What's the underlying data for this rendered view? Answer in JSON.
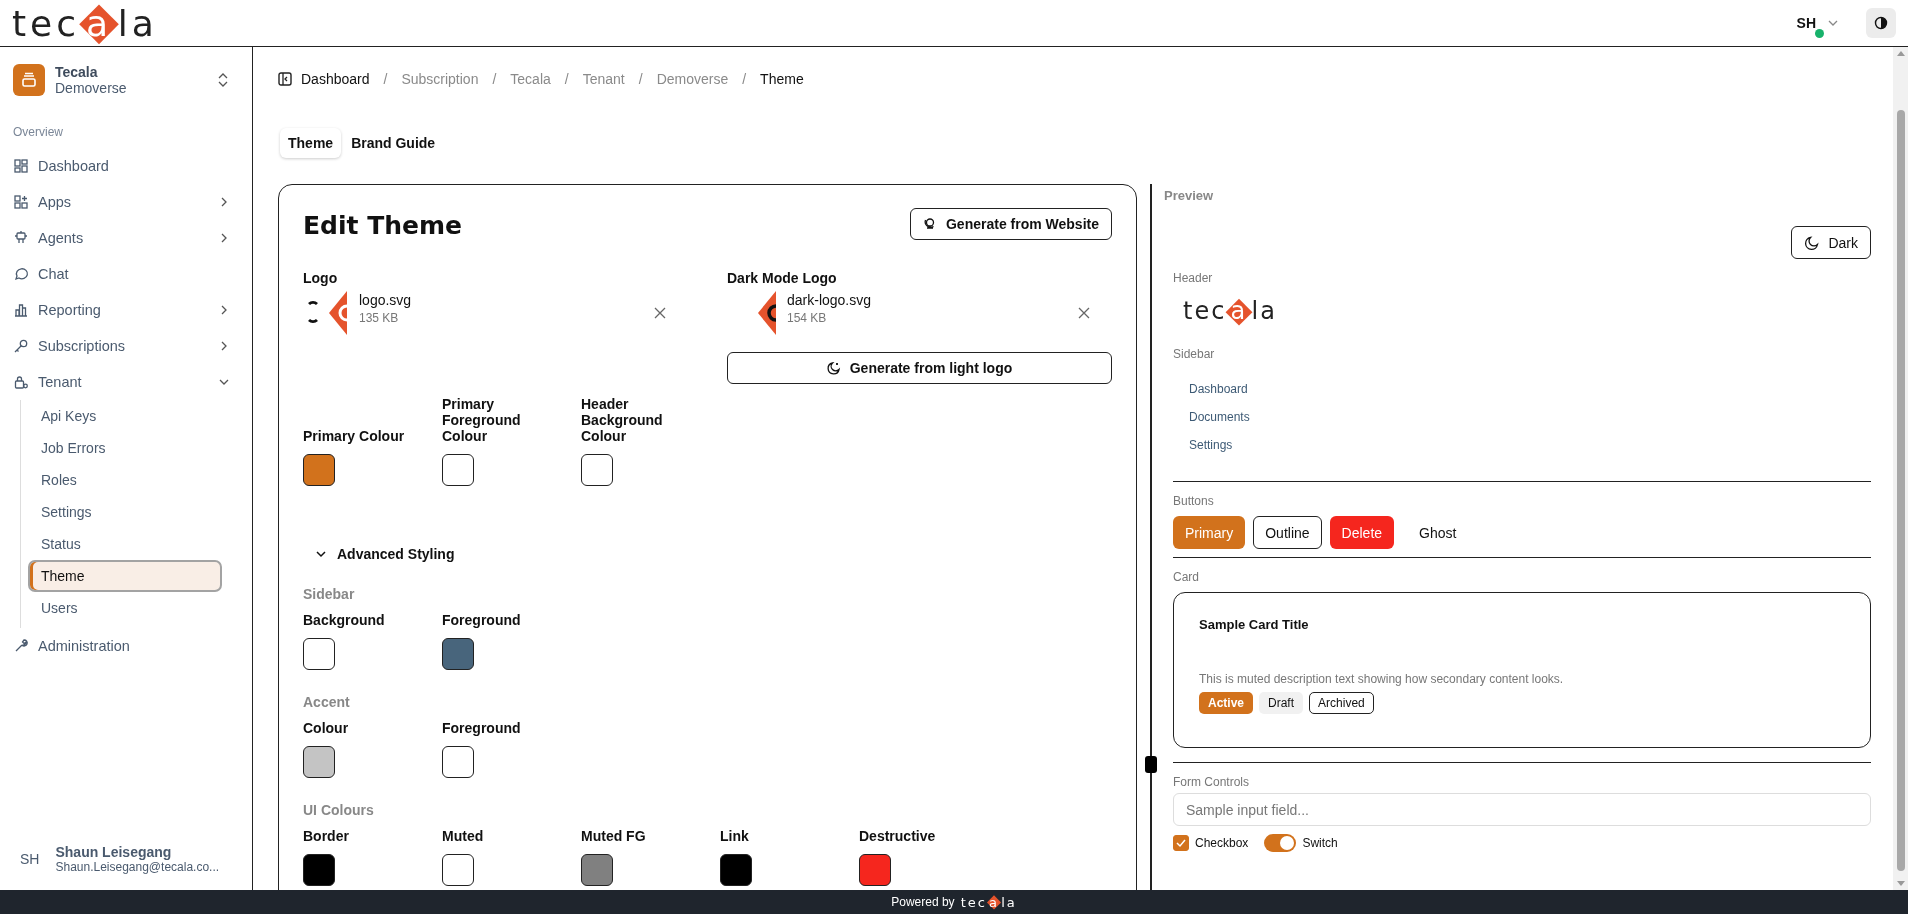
{
  "header": {
    "logo": {
      "lead": "tec",
      "mark": "a",
      "tail": "la"
    },
    "user": {
      "initials": "SH",
      "online": true
    }
  },
  "sidebar": {
    "org": {
      "name": "Tecala",
      "subtitle": "Demoverse"
    },
    "section": "Overview",
    "items": [
      {
        "label": "Dashboard"
      },
      {
        "label": "Apps",
        "expanded": false
      },
      {
        "label": "Agents",
        "expanded": false
      },
      {
        "label": "Chat"
      },
      {
        "label": "Reporting",
        "expanded": false
      },
      {
        "label": "Subscriptions",
        "expanded": false
      },
      {
        "label": "Tenant",
        "expanded": true,
        "children": [
          {
            "label": "Api Keys",
            "selected": false
          },
          {
            "label": "Job Errors",
            "selected": false
          },
          {
            "label": "Roles",
            "selected": false
          },
          {
            "label": "Settings",
            "selected": false
          },
          {
            "label": "Status",
            "selected": false
          },
          {
            "label": "Theme",
            "selected": true
          },
          {
            "label": "Users",
            "selected": false
          }
        ]
      },
      {
        "label": "Administration"
      }
    ],
    "user": {
      "initials": "SH",
      "name": "Shaun Leisegang",
      "email": "Shaun.Leisegang@tecala.co..."
    }
  },
  "breadcrumbs": [
    {
      "label": "Dashboard",
      "kind": "root"
    },
    {
      "separator": "/",
      "label": "Subscription",
      "kind": "link"
    },
    {
      "separator": "/",
      "label": "Tecala",
      "kind": "link"
    },
    {
      "separator": "/",
      "label": "Tenant",
      "kind": "link"
    },
    {
      "separator": "/",
      "label": "Demoverse",
      "kind": "link"
    },
    {
      "separator": "/",
      "label": "Theme",
      "kind": "current"
    }
  ],
  "tabs": [
    {
      "label": "Theme",
      "selected": true
    },
    {
      "label": "Brand Guide",
      "selected": false
    }
  ],
  "editor": {
    "title": "Edit Theme",
    "generate_button": "Generate from Website",
    "logos": [
      {
        "label": "Logo",
        "file": "logo.svg",
        "size": "135 KB",
        "kind": "light"
      },
      {
        "label": "Dark Mode Logo",
        "file": "dark-logo.svg",
        "size": "154 KB",
        "kind": "dark"
      }
    ],
    "generate_dark_button": "Generate from light logo",
    "main_colours": [
      {
        "label": "Primary Colour",
        "color": "#d2721c"
      },
      {
        "label": "Primary Foreground Colour",
        "color": "#ffffff"
      },
      {
        "label": "Header Background Colour",
        "color": "#ffffff"
      }
    ],
    "advanced": {
      "label": "Advanced Styling",
      "expanded": true,
      "groups": [
        {
          "title": "Sidebar",
          "colours": [
            {
              "label": "Background",
              "color": "#ffffff"
            },
            {
              "label": "Foreground",
              "color": "#48657c"
            }
          ]
        },
        {
          "title": "Accent",
          "colours": [
            {
              "label": "Colour",
              "color": "#c4c4c4"
            },
            {
              "label": "Foreground",
              "color": "#ffffff"
            }
          ]
        },
        {
          "title": "UI Colours",
          "colours": [
            {
              "label": "Border",
              "color": "#000000"
            },
            {
              "label": "Muted",
              "color": "#ffffff"
            },
            {
              "label": "Muted FG",
              "color": "#808080"
            },
            {
              "label": "Link",
              "color": "#000000"
            },
            {
              "label": "Destructive",
              "color": "#f5261e"
            }
          ]
        }
      ]
    }
  },
  "preview": {
    "title": "Preview",
    "mode_button": "Dark",
    "header_label": "Header",
    "logo": {
      "lead": "tec",
      "mark": "a",
      "tail": "la"
    },
    "sidebar_label": "Sidebar",
    "sidebar_items": [
      "Dashboard",
      "Documents",
      "Settings"
    ],
    "buttons_label": "Buttons",
    "buttons": [
      {
        "label": "Primary",
        "kind": "primary"
      },
      {
        "label": "Outline",
        "kind": "outline"
      },
      {
        "label": "Delete",
        "kind": "destructive"
      },
      {
        "label": "Ghost",
        "kind": "ghost"
      }
    ],
    "card_label": "Card",
    "card": {
      "title": "Sample Card Title",
      "description": "This is muted description text showing how secondary content looks.",
      "badges": [
        {
          "label": "Active",
          "kind": "primary"
        },
        {
          "label": "Draft",
          "kind": "muted"
        },
        {
          "label": "Archived",
          "kind": "outline"
        }
      ]
    },
    "form_label": "Form Controls",
    "input": {
      "placeholder": "Sample input field..."
    },
    "checkbox": {
      "label": "Checkbox",
      "checked": true
    },
    "switch": {
      "label": "Switch",
      "on": true
    }
  },
  "footer": {
    "text": "Powered by",
    "logo": {
      "lead": "tec",
      "mark": "a",
      "tail": "la"
    }
  }
}
